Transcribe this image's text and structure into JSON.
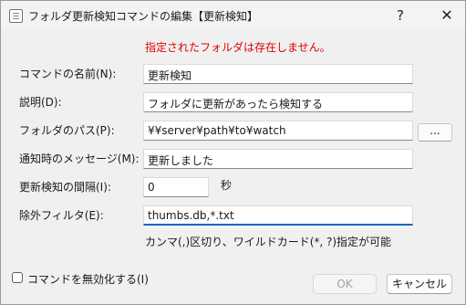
{
  "title": "フォルダ更新検知コマンドの編集【更新検知】",
  "title_buttons": {
    "help": "?",
    "close": "✕"
  },
  "error_message": "指定されたフォルダは存在しません。",
  "fields": {
    "command_name": {
      "label": "コマンドの名前(N):",
      "value": "更新検知"
    },
    "description": {
      "label": "説明(D):",
      "value": "フォルダに更新があったら検知する"
    },
    "folder_path": {
      "label": "フォルダのパス(P):",
      "value": "¥¥server¥path¥to¥watch",
      "browse_label": "..."
    },
    "notify_message": {
      "label": "通知時のメッセージ(M):",
      "value": "更新しました"
    },
    "interval": {
      "label": "更新検知の間隔(I):",
      "value": "0",
      "unit": "秒"
    },
    "exclude_filter": {
      "label": "除外フィルタ(E):",
      "value": "thumbs.db,*.txt",
      "hint": "カンマ(,)区切り、ワイルドカード(*, ?)指定が可能"
    }
  },
  "disable_checkbox": {
    "label": "コマンドを無効化する(I)",
    "checked": false
  },
  "buttons": {
    "ok": "OK",
    "cancel": "キャンセル"
  },
  "colors": {
    "error": "#e00000",
    "focus": "#0067c0"
  }
}
